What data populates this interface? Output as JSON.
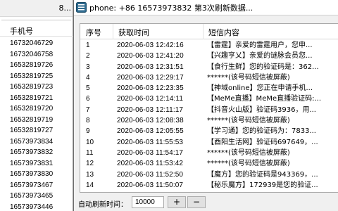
{
  "left_window": {
    "title_fragment": "8...",
    "column_header": "手机号",
    "phones": [
      "16732046729",
      "16732046758",
      "16532819726",
      "16532819725",
      "16532819723",
      "16532819721",
      "16532819720",
      "16532819719",
      "16532819727",
      "16573973834",
      "16573973832",
      "16573973831",
      "16573973830",
      "16573973467",
      "16573973465",
      "16573973446"
    ]
  },
  "right_window": {
    "title": "phone: +86 16573973832  第3次刷新数据...",
    "icon": "app-list-icon",
    "columns": [
      "序号",
      "获取时间",
      "短信内容"
    ],
    "rows": [
      {
        "idx": "1",
        "time": "2020-06-03 12:42:16",
        "content": "【雷霆】亲爱的雷霆用户，您申..."
      },
      {
        "idx": "2",
        "time": "2020-06-03 12:41:20",
        "content": "【兴趣亨乂】亲爱的谜脉会员您..."
      },
      {
        "idx": "3",
        "time": "2020-06-03 12:31:51",
        "content": "【食行生鲜】您的验证码是：362..."
      },
      {
        "idx": "4",
        "time": "2020-06-03 12:29:17",
        "content": "******(该号码短信被屏蔽)"
      },
      {
        "idx": "5",
        "time": "2020-06-03 12:23:35",
        "content": "【神域online】您正在申请手机..."
      },
      {
        "idx": "6",
        "time": "2020-06-03 12:14:11",
        "content": "【MeMe直播】MeMe直播验证码:..."
      },
      {
        "idx": "7",
        "time": "2020-06-03 12:11:17",
        "content": "【抖音火山版】验证码3936，用..."
      },
      {
        "idx": "8",
        "time": "2020-06-03 12:08:38",
        "content": "******(该号码短信被屏蔽)"
      },
      {
        "idx": "9",
        "time": "2020-06-03 12:05:55",
        "content": "【学习通】您的验证码为：7833..."
      },
      {
        "idx": "10",
        "time": "2020-06-03 11:55:53",
        "content": "【酉阳生活网】验证码697649，..."
      },
      {
        "idx": "11",
        "time": "2020-06-03 11:54:17",
        "content": "******(该号码短信被屏蔽)"
      },
      {
        "idx": "12",
        "time": "2020-06-03 11:53:42",
        "content": "******(该号码短信被屏蔽)"
      },
      {
        "idx": "13",
        "time": "2020-06-03 11:52:50",
        "content": "【魔方】您的验证码是943369，..."
      },
      {
        "idx": "14",
        "time": "2020-06-03 11:50:07",
        "content": "【秘乐魔方】172939是您的验证..."
      }
    ],
    "bottom": {
      "refresh_label": "自动刷新时间：",
      "refresh_value": "10000",
      "plus_label": "+",
      "minus_label": "−"
    }
  }
}
